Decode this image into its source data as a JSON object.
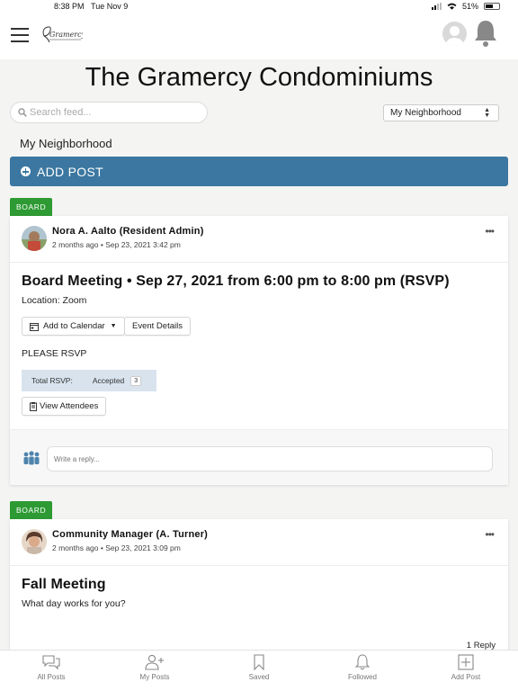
{
  "status_bar": {
    "time": "8:38 PM",
    "date": "Tue Nov 9",
    "battery": "51%"
  },
  "header": {
    "logo_text": "Gramercy"
  },
  "site": {
    "title": "The Gramercy Condominiums"
  },
  "search": {
    "placeholder": "Search feed..."
  },
  "filter": {
    "selected": "My Neighborhood"
  },
  "section_label": "My Neighborhood",
  "add_post_label": "ADD POST",
  "colors": {
    "accent": "#3b77a0",
    "tag": "#2d9a33",
    "rsvp_bg": "#d8e3ee"
  },
  "posts": [
    {
      "tag": "BOARD",
      "author": "Nora A. Aalto (Resident Admin)",
      "meta": "2 months ago • Sep 23, 2021 3:42 pm",
      "title": "Board Meeting • Sep 27, 2021 from 6:00 pm to 8:00 pm (RSVP)",
      "location": "Location: Zoom",
      "add_calendar_label": "Add to Calendar",
      "event_details_label": "Event Details",
      "body": "PLEASE RSVP",
      "rsvp": {
        "total_label": "Total RSVP:",
        "accepted_label": "Accepted",
        "accepted_count": "3"
      },
      "view_attendees_label": "View Attendees",
      "reply_placeholder": "Write a reply..."
    },
    {
      "tag": "BOARD",
      "author": "Community Manager (A. Turner)",
      "meta": "2 months ago • Sep 23, 2021 3:09 pm",
      "title": "Fall Meeting",
      "body": "What day works for you?",
      "replies": "1 Reply"
    }
  ],
  "tabs": [
    {
      "label": "All Posts",
      "icon": "chat-bubbles-icon"
    },
    {
      "label": "My Posts",
      "icon": "add-person-icon"
    },
    {
      "label": "Saved",
      "icon": "bookmark-icon"
    },
    {
      "label": "Followed",
      "icon": "bell-icon"
    },
    {
      "label": "Add Post",
      "icon": "plus-square-icon"
    }
  ]
}
